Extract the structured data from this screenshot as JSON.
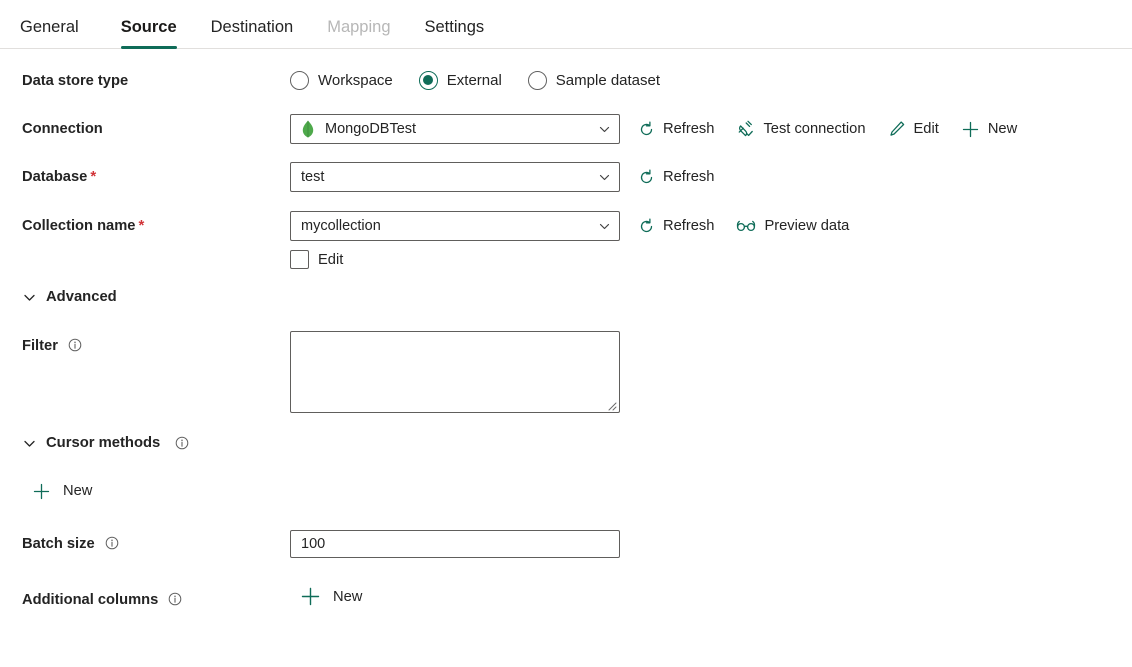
{
  "theme": {
    "accent": "#0f6c58",
    "required_asterisk": "#d13438",
    "mongo_green": "#4ea94b"
  },
  "tabs": [
    {
      "label": "General",
      "state": "normal"
    },
    {
      "label": "Source",
      "state": "active"
    },
    {
      "label": "Destination",
      "state": "normal"
    },
    {
      "label": "Mapping",
      "state": "disabled"
    },
    {
      "label": "Settings",
      "state": "normal"
    }
  ],
  "data_store_type": {
    "label": "Data store type",
    "options": [
      {
        "label": "Workspace",
        "selected": false
      },
      {
        "label": "External",
        "selected": true
      },
      {
        "label": "Sample dataset",
        "selected": false
      }
    ]
  },
  "connection": {
    "label": "Connection",
    "value": "MongoDBTest",
    "icon": "mongodb-leaf-icon",
    "commands": [
      {
        "label": "Refresh",
        "icon": "refresh-icon"
      },
      {
        "label": "Test connection",
        "icon": "plug-check-icon"
      },
      {
        "label": "Edit",
        "icon": "pencil-icon"
      },
      {
        "label": "New",
        "icon": "plus-icon"
      }
    ]
  },
  "database": {
    "label": "Database",
    "required": "*",
    "value": "test",
    "commands": [
      {
        "label": "Refresh",
        "icon": "refresh-icon"
      }
    ]
  },
  "collection": {
    "label": "Collection name",
    "required": "*",
    "value": "mycollection",
    "commands": [
      {
        "label": "Refresh",
        "icon": "refresh-icon"
      },
      {
        "label": "Preview data",
        "icon": "glasses-icon"
      }
    ],
    "edit_checkbox": {
      "label": "Edit",
      "checked": false
    }
  },
  "advanced": {
    "label": "Advanced",
    "expanded": true
  },
  "filter": {
    "label": "Filter",
    "value": "",
    "placeholder": "",
    "info": "info-icon"
  },
  "cursor_methods": {
    "label": "Cursor methods",
    "expanded": true,
    "info": "info-icon",
    "new_label": "New"
  },
  "batch_size": {
    "label": "Batch size",
    "value": "100",
    "info": "info-icon"
  },
  "additional_columns": {
    "label": "Additional columns",
    "info": "info-icon",
    "new_label": "New"
  }
}
